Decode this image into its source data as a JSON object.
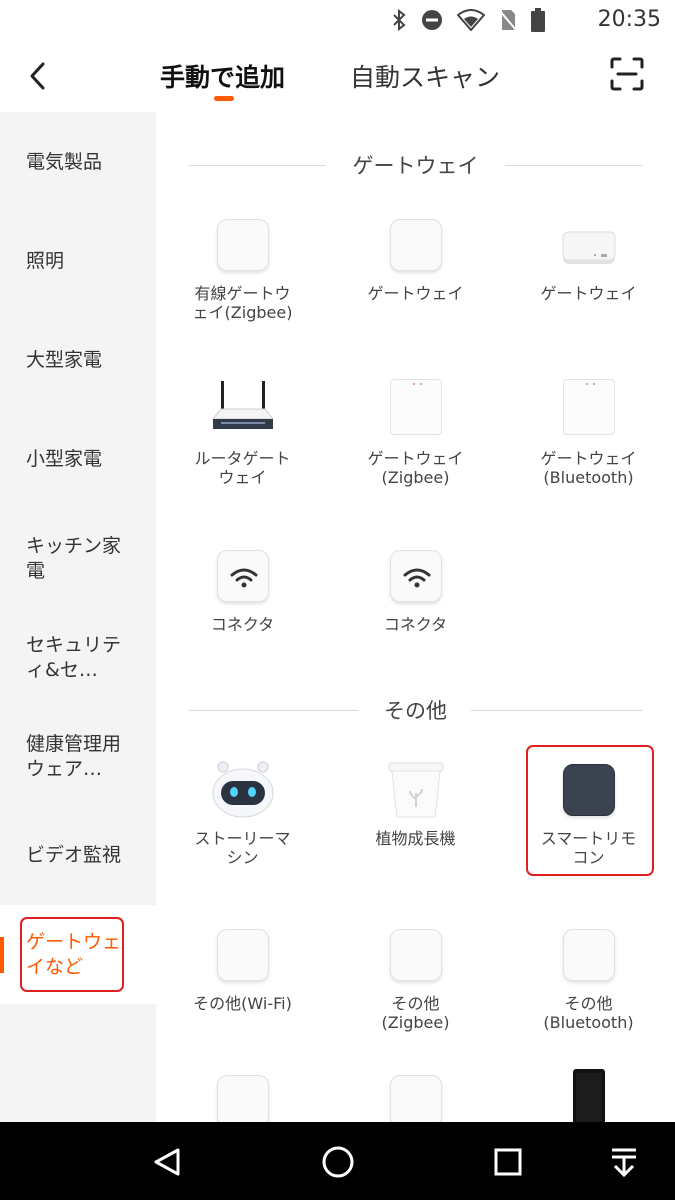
{
  "status_bar": {
    "time": "20:35",
    "icons": [
      "bluetooth-icon",
      "do-not-disturb-icon",
      "wifi-icon",
      "no-sim-icon",
      "battery-icon"
    ]
  },
  "header": {
    "back_icon": "chevron-left-icon",
    "tabs": [
      {
        "label": "手動で追加",
        "active": true
      },
      {
        "label": "自動スキャン",
        "active": false
      }
    ],
    "scan_icon": "scan-icon",
    "accent_color": "#ff5a00"
  },
  "sidebar": {
    "items": [
      {
        "label": "電気製品"
      },
      {
        "label": "照明"
      },
      {
        "label": "大型家電"
      },
      {
        "label": "小型家電"
      },
      {
        "label": "キッチン家電"
      },
      {
        "label": "セキュリティ&セ…"
      },
      {
        "label": "健康管理用ウェア…"
      },
      {
        "label": "ビデオ監視"
      },
      {
        "label": "ゲートウェイなど",
        "active": true
      }
    ]
  },
  "sections": [
    {
      "title": "ゲートウェイ",
      "devices": [
        {
          "label": "有線ゲートウ\nェイ(Zigbee)",
          "icon": "white-hub-icon"
        },
        {
          "label": "ゲートウェイ",
          "icon": "white-hub-icon"
        },
        {
          "label": "ゲートウェイ",
          "icon": "gateway-box-icon"
        },
        {
          "label": "ルータゲート\nウェイ",
          "icon": "router-icon"
        },
        {
          "label": "ゲートウェイ\n(Zigbee)",
          "icon": "plug-gateway-icon"
        },
        {
          "label": "ゲートウェイ\n(Bluetooth)",
          "icon": "plug-gateway-icon"
        },
        {
          "label": "コネクタ",
          "icon": "wifi-connector-icon"
        },
        {
          "label": "コネクタ",
          "icon": "wifi-connector-icon"
        }
      ]
    },
    {
      "title": "その他",
      "devices": [
        {
          "label": "ストーリーマ\nシン",
          "icon": "robot-icon"
        },
        {
          "label": "植物成長機",
          "icon": "plant-pot-icon"
        },
        {
          "label": "スマートリモ\nコン",
          "icon": "smart-remote-icon",
          "highlighted": true
        },
        {
          "label": "その他(Wi-Fi)",
          "icon": "white-hub-icon"
        },
        {
          "label": "その他\n(Zigbee)",
          "icon": "white-hub-icon"
        },
        {
          "label": "その他\n(Bluetooth)",
          "icon": "white-hub-icon"
        },
        {
          "label": "",
          "icon": "white-hub-icon"
        },
        {
          "label": "",
          "icon": "white-hub-icon"
        },
        {
          "label": "",
          "icon": "speaker-icon"
        }
      ]
    }
  ],
  "nav_bar": {
    "buttons": [
      "back-triangle-icon",
      "home-circle-icon",
      "recents-square-icon",
      "notifications-down-icon"
    ]
  }
}
